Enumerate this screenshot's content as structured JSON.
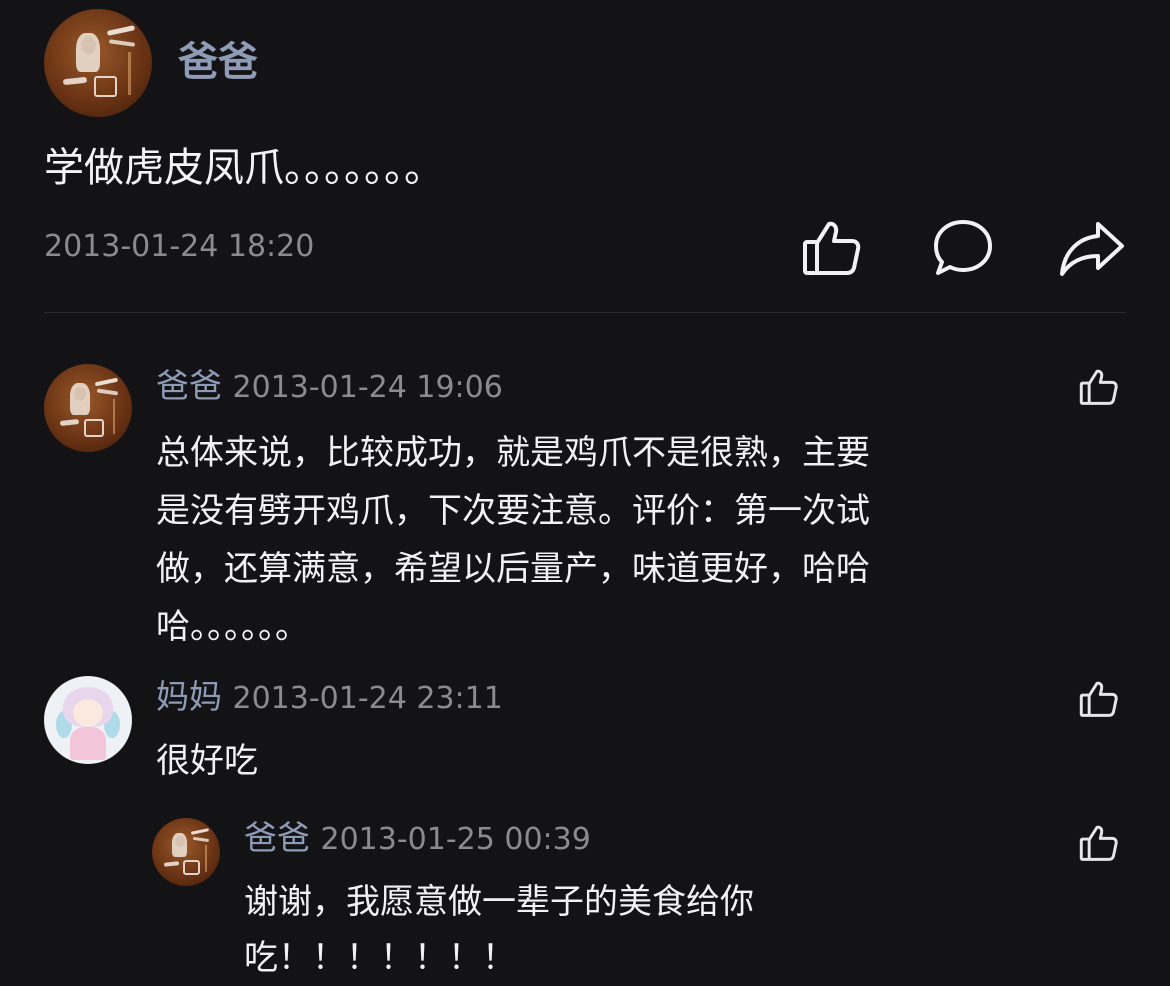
{
  "post": {
    "author": "爸爸",
    "text": "学做虎皮凤爪。。。。。。。",
    "timestamp": "2013-01-24 18:20",
    "actions": [
      "like-icon",
      "comment-icon",
      "share-icon"
    ]
  },
  "comments": [
    {
      "author": "爸爸",
      "timestamp": "2013-01-24 19:06",
      "lines": [
        "总体来说，比较成功，就是鸡爪不是很熟，主要",
        "是没有劈开鸡爪，下次要注意。评价：第一次试",
        "做，还算满意，希望以后量产，味道更好，哈哈",
        "哈。。。。。。"
      ]
    },
    {
      "author": "妈妈",
      "timestamp": "2013-01-24 23:11",
      "lines": [
        "很好吃"
      ]
    }
  ],
  "reply": {
    "author": "爸爸",
    "timestamp": "2013-01-25 00:39",
    "lines": [
      "谢谢，我愿意做一辈子的美食给你",
      "吃！！！！！！！"
    ]
  },
  "colors": {
    "background": "#131316",
    "name": "#8e9bb5",
    "timestamp": "#8a8a8f",
    "text": "#f2f2f2"
  }
}
